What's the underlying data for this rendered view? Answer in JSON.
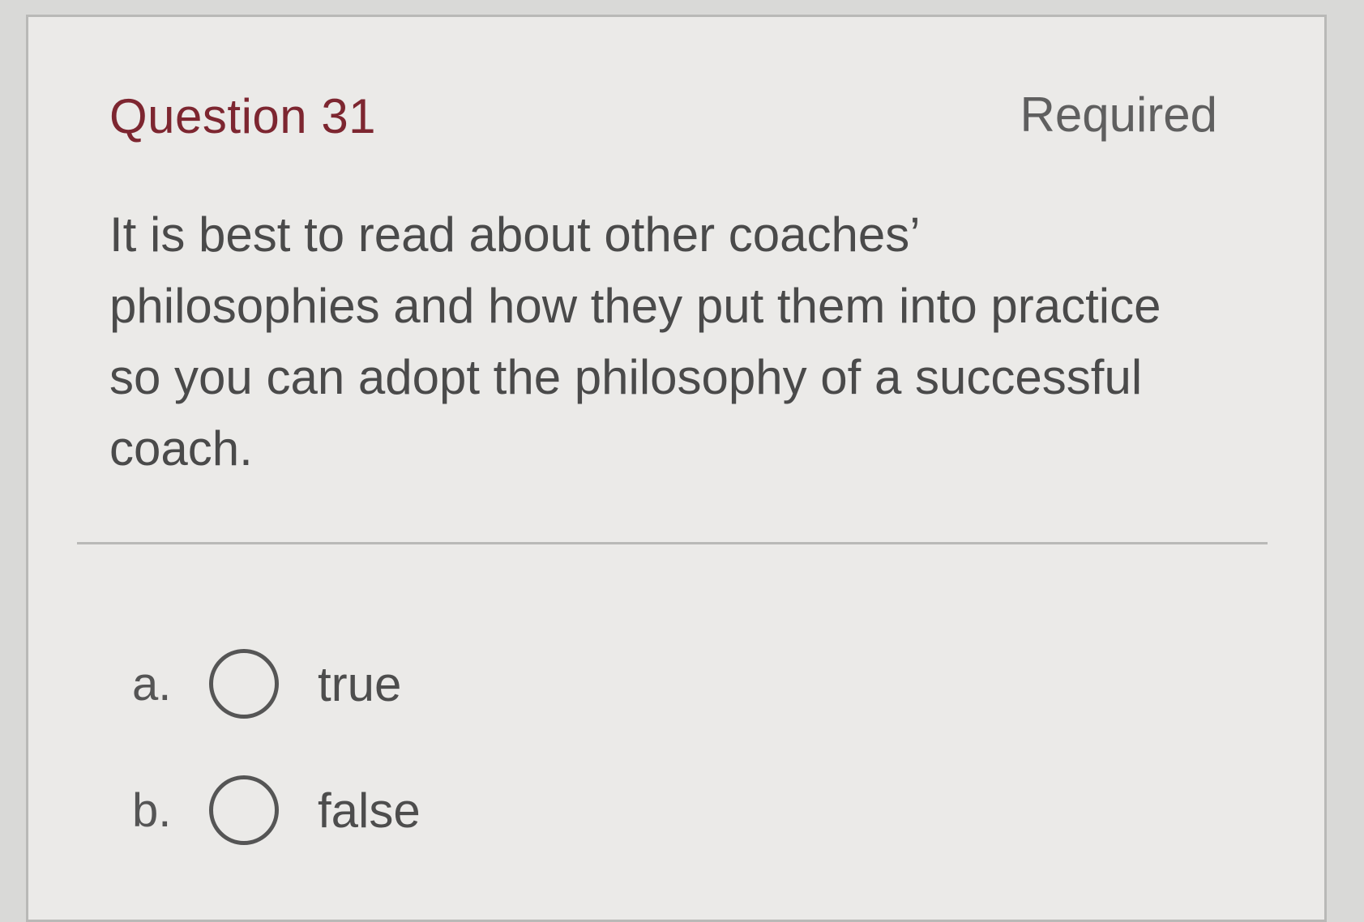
{
  "question": {
    "title": "Question 31",
    "required_label": "Required",
    "text": "It is best to read about other coaches’ philosophies and how they put them into practice so you can adopt the philosophy of a successful coach."
  },
  "options": [
    {
      "letter": "a.",
      "label": "true",
      "selected": false
    },
    {
      "letter": "b.",
      "label": "false",
      "selected": false
    }
  ],
  "colors": {
    "title": "#7d2630",
    "background": "#ebeae8",
    "text": "#4a4a4a"
  }
}
